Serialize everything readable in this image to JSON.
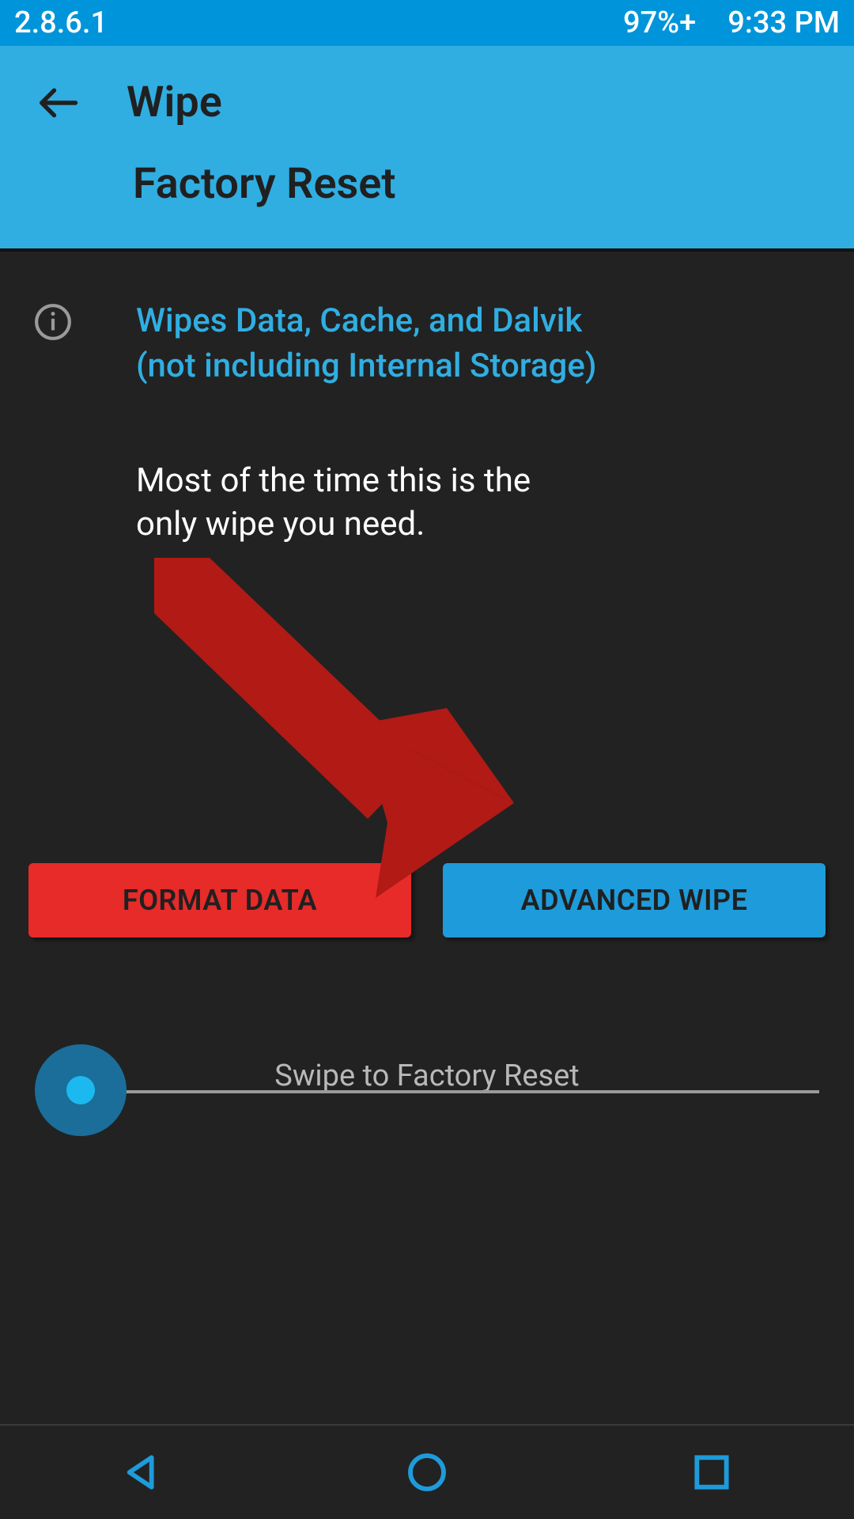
{
  "status": {
    "version": "2.8.6.1",
    "battery": "97%+",
    "time": "9:33 PM"
  },
  "header": {
    "title": "Wipe",
    "subtitle": "Factory Reset"
  },
  "info": {
    "line1": "Wipes Data, Cache, and Dalvik",
    "line2": "(not including Internal Storage)"
  },
  "body": "Most of the time this is the only wipe you need.",
  "buttons": {
    "format": "FORMAT DATA",
    "advanced": "ADVANCED WIPE"
  },
  "swipe": {
    "label": "Swipe to Factory Reset"
  },
  "colors": {
    "status_bg": "#0095da",
    "header_bg": "#30aee2",
    "accent": "#1e9bda",
    "danger": "#e62b29",
    "annotation": "#b11a15"
  }
}
